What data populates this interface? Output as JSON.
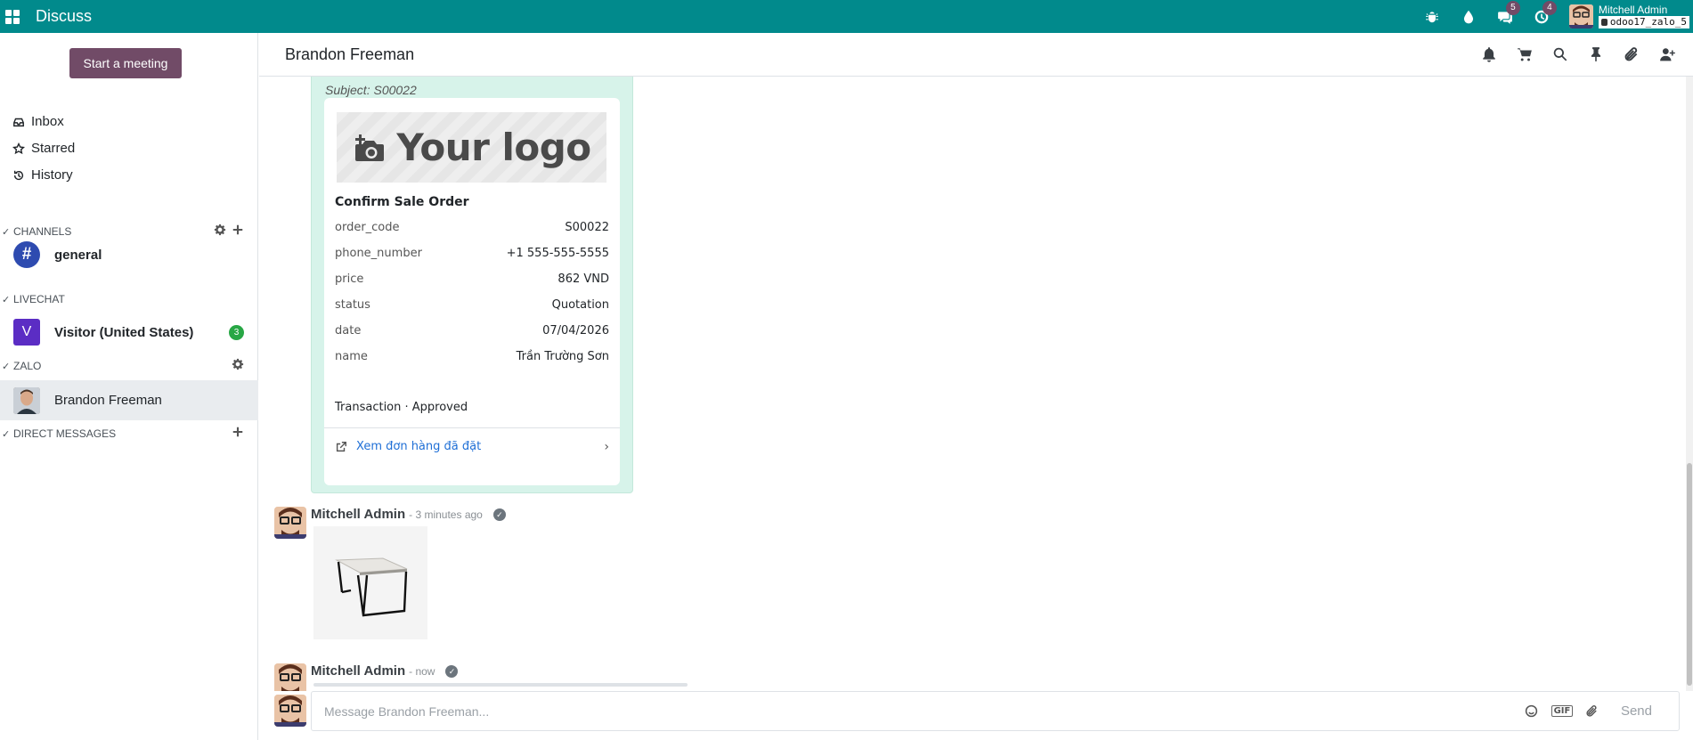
{
  "navbar": {
    "app_title": "Discuss",
    "user_name": "Mitchell Admin",
    "database": "odoo17_zalo_5",
    "chat_badge": "5",
    "activity_badge": "4",
    "icons": [
      "apps-icon",
      "bug-icon",
      "drop-icon",
      "chat-icon",
      "clock-icon"
    ],
    "color": "#018a8c"
  },
  "sidebar": {
    "start_meeting": "Start a meeting",
    "mailboxes": [
      {
        "label": "Inbox",
        "icon": "inbox-icon"
      },
      {
        "label": "Starred",
        "icon": "star-icon"
      },
      {
        "label": "History",
        "icon": "history-icon"
      }
    ],
    "categories": {
      "channels": "CHANNELS",
      "livechat": "LIVECHAT",
      "zalo": "ZALO",
      "direct": "DIRECT MESSAGES"
    },
    "channels": [
      {
        "name": "general",
        "avatar_text": "#"
      }
    ],
    "livechat": [
      {
        "name": "Visitor (United States)",
        "avatar_text": "V",
        "unread": "3"
      }
    ],
    "zalo": [
      {
        "name": "Brandon Freeman"
      }
    ],
    "accent": "#714b67"
  },
  "thread": {
    "title": "Brandon Freeman",
    "header_icons": [
      "bell-icon",
      "cart-icon",
      "search-icon",
      "pin-icon",
      "paperclip-icon",
      "add-user-icon"
    ]
  },
  "card_message": {
    "subject": "Subject: S00022",
    "logo_text": "Your logo",
    "title": "Confirm Sale Order",
    "rows": [
      {
        "key": "order_code",
        "value": "S00022"
      },
      {
        "key": "phone_number",
        "value": "+1 555-555-5555"
      },
      {
        "key": "price",
        "value": "862 VND"
      },
      {
        "key": "status",
        "value": "Quotation"
      },
      {
        "key": "date",
        "value": "07/04/2026"
      },
      {
        "key": "name",
        "value": "Trần Trường Sơn"
      }
    ],
    "transaction": "Transaction · Approved",
    "link_label": "Xem đơn hàng đã đặt"
  },
  "messages": [
    {
      "author": "Mitchell Admin",
      "time": "- 3 minutes ago"
    },
    {
      "author": "Mitchell Admin",
      "time": "- now"
    }
  ],
  "composer": {
    "placeholder": "Message Brandon Freeman...",
    "gif_label": "GIF",
    "send_label": "Send"
  }
}
